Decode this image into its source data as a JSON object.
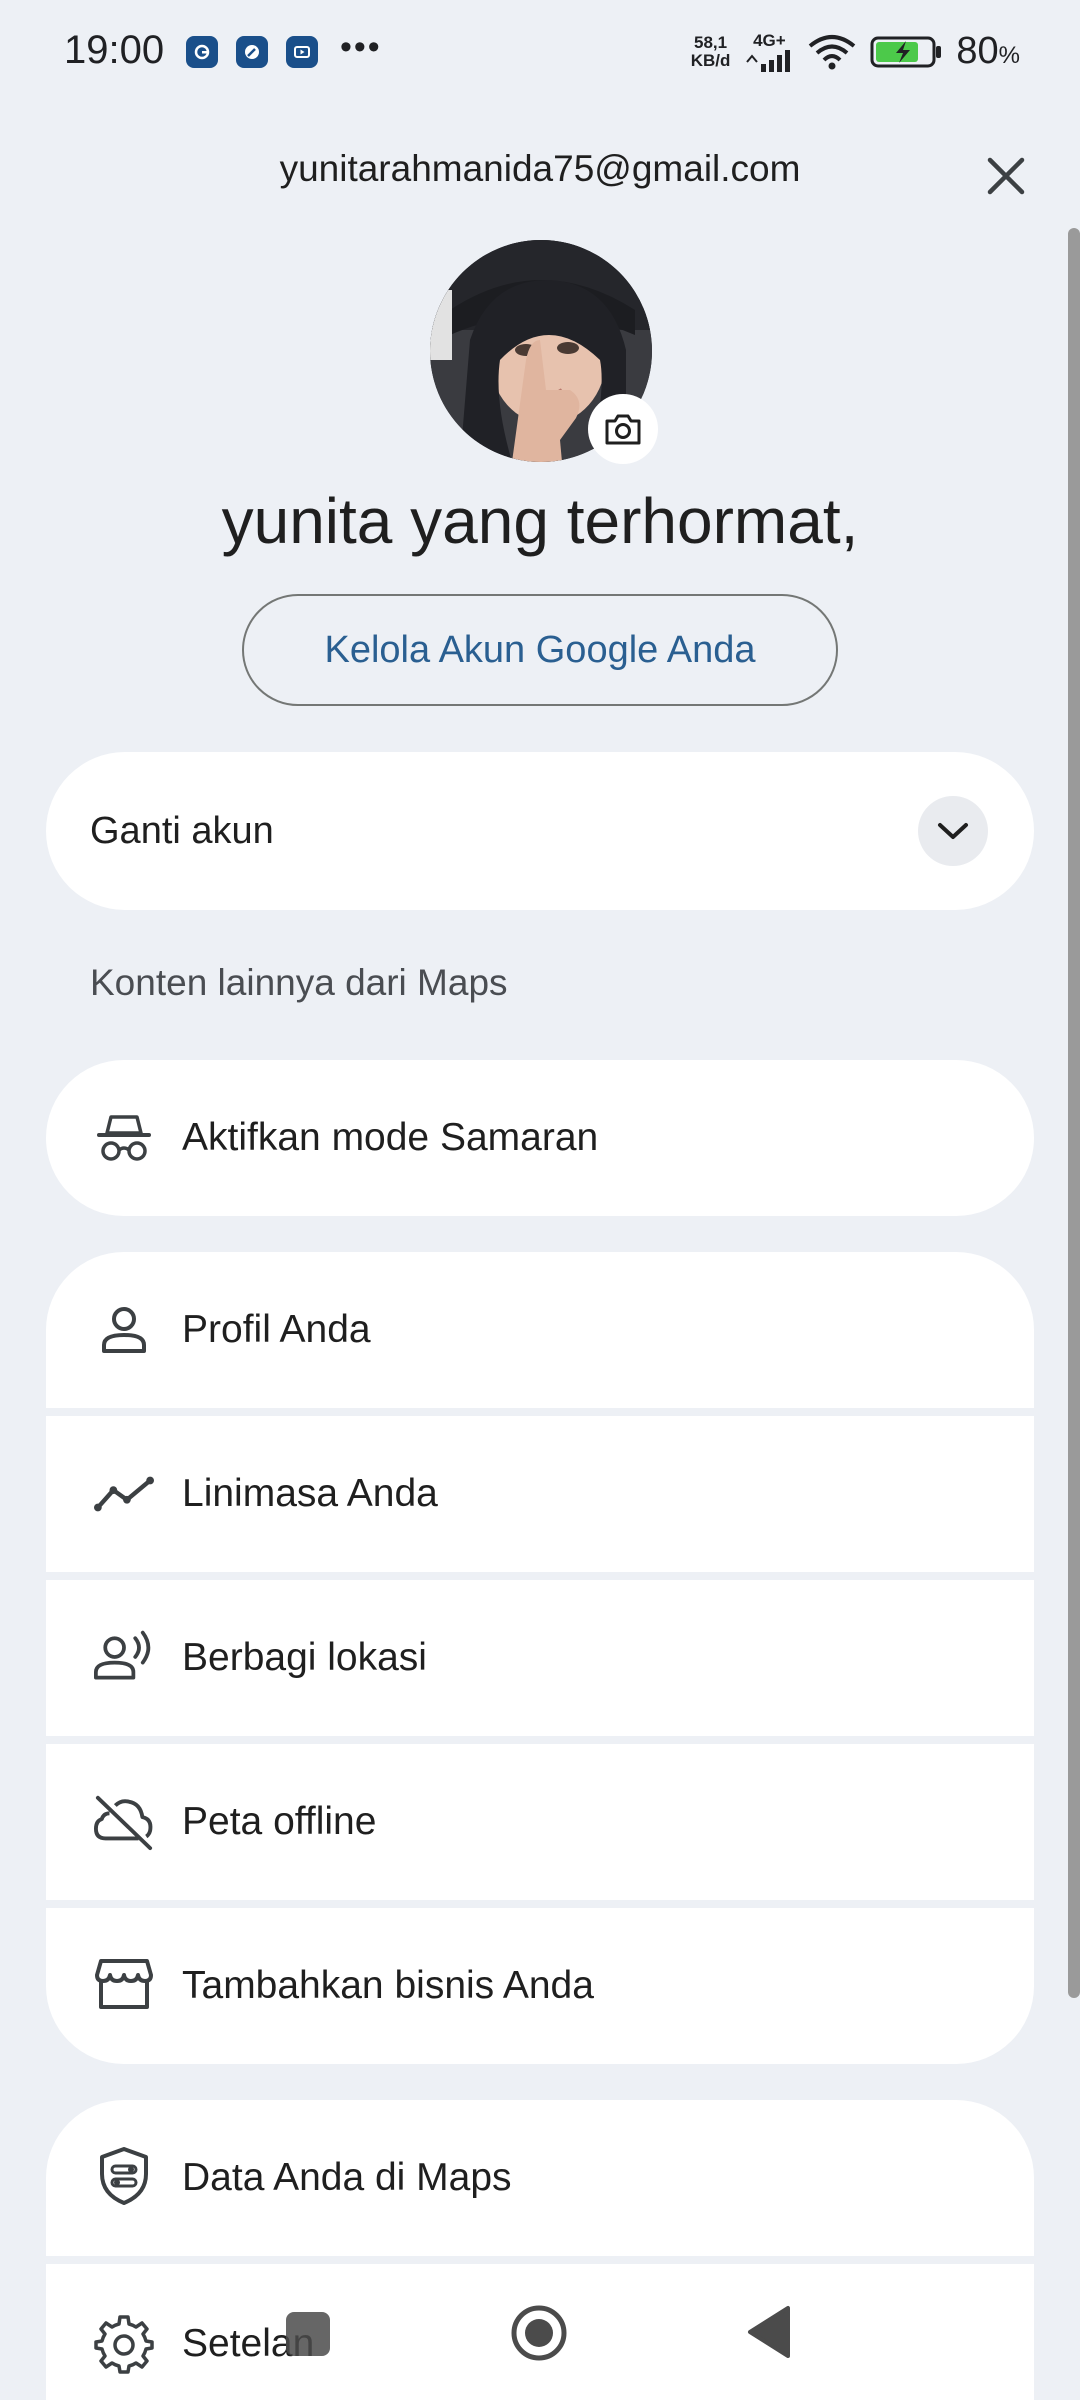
{
  "status_bar": {
    "time": "19:00",
    "net_speed_value": "58,1",
    "net_speed_unit": "KB/d",
    "net_type": "4G+",
    "battery_percent": "80",
    "battery_symbol": "%",
    "notif_more": "•••"
  },
  "header": {
    "email": "yunitarahmanida75@gmail.com"
  },
  "profile": {
    "greeting": "yunita yang terhormat,",
    "manage_button": "Kelola Akun Google Anda"
  },
  "switch_account": {
    "label": "Ganti akun"
  },
  "section": {
    "heading": "Konten lainnya dari Maps"
  },
  "menu": {
    "incognito": "Aktifkan mode Samaran",
    "profile": "Profil Anda",
    "timeline": "Linimasa Anda",
    "location_sharing": "Berbagi lokasi",
    "offline_maps": "Peta offline",
    "add_business": "Tambahkan bisnis Anda",
    "your_data": "Data Anda di Maps",
    "settings": "Setelan"
  },
  "colors": {
    "background": "#edf0f5",
    "accent_text": "#2a5f91",
    "card": "#ffffff"
  }
}
